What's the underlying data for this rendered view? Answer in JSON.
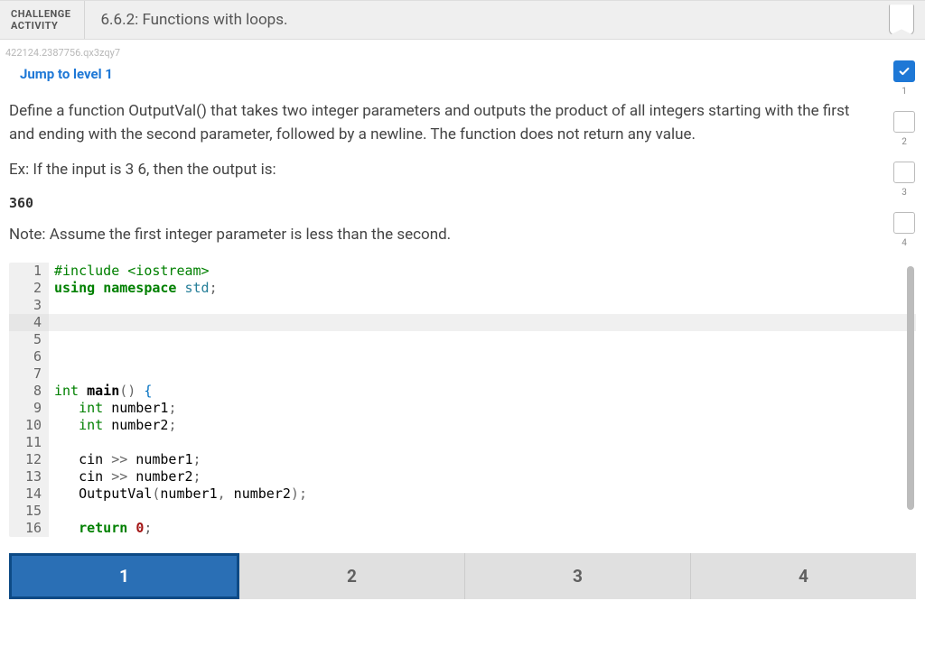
{
  "header": {
    "type_line1": "CHALLENGE",
    "type_line2": "ACTIVITY",
    "title": "6.6.2: Functions with loops."
  },
  "tracking_id": "422124.2387756.qx3zqy7",
  "jump_link": "Jump to level 1",
  "problem": {
    "description": "Define a function OutputVal() that takes two integer parameters and outputs the product of all integers starting with the first and ending with the second parameter, followed by a newline. The function does not return any value.",
    "example_prefix": "Ex: If the input is 3 6, then the output is:",
    "example_output": "360",
    "note": "Note: Assume the first integer parameter is less than the second."
  },
  "code_lines": [
    {
      "n": 1,
      "tokens": [
        {
          "t": "#include ",
          "c": "tok-inc"
        },
        {
          "t": "<iostream>",
          "c": "tok-str"
        }
      ]
    },
    {
      "n": 2,
      "tokens": [
        {
          "t": "using",
          "c": "tok-kw"
        },
        {
          "t": " ",
          "c": ""
        },
        {
          "t": "namespace",
          "c": "tok-kw"
        },
        {
          "t": " ",
          "c": ""
        },
        {
          "t": "std",
          "c": "tok-ns"
        },
        {
          "t": ";",
          "c": "tok-punc"
        }
      ]
    },
    {
      "n": 3,
      "tokens": []
    },
    {
      "n": 4,
      "tokens": [],
      "current": true
    },
    {
      "n": 5,
      "tokens": []
    },
    {
      "n": 6,
      "tokens": []
    },
    {
      "n": 7,
      "tokens": []
    },
    {
      "n": 8,
      "tokens": [
        {
          "t": "int",
          "c": "tok-type"
        },
        {
          "t": " ",
          "c": ""
        },
        {
          "t": "main",
          "c": "tok-fn"
        },
        {
          "t": "()",
          "c": "tok-punc"
        },
        {
          "t": " ",
          "c": ""
        },
        {
          "t": "{",
          "c": "tok-brace"
        }
      ]
    },
    {
      "n": 9,
      "tokens": [
        {
          "t": "   ",
          "c": ""
        },
        {
          "t": "int",
          "c": "tok-type"
        },
        {
          "t": " number1",
          "c": "tok-ident"
        },
        {
          "t": ";",
          "c": "tok-punc"
        }
      ]
    },
    {
      "n": 10,
      "tokens": [
        {
          "t": "   ",
          "c": ""
        },
        {
          "t": "int",
          "c": "tok-type"
        },
        {
          "t": " number2",
          "c": "tok-ident"
        },
        {
          "t": ";",
          "c": "tok-punc"
        }
      ]
    },
    {
      "n": 11,
      "tokens": []
    },
    {
      "n": 12,
      "tokens": [
        {
          "t": "   cin ",
          "c": "tok-ident"
        },
        {
          "t": ">>",
          "c": "tok-op"
        },
        {
          "t": " number1",
          "c": "tok-ident"
        },
        {
          "t": ";",
          "c": "tok-punc"
        }
      ]
    },
    {
      "n": 13,
      "tokens": [
        {
          "t": "   cin ",
          "c": "tok-ident"
        },
        {
          "t": ">>",
          "c": "tok-op"
        },
        {
          "t": " number2",
          "c": "tok-ident"
        },
        {
          "t": ";",
          "c": "tok-punc"
        }
      ]
    },
    {
      "n": 14,
      "tokens": [
        {
          "t": "   OutputVal",
          "c": "tok-ident"
        },
        {
          "t": "(",
          "c": "tok-punc"
        },
        {
          "t": "number1",
          "c": "tok-ident"
        },
        {
          "t": ",",
          "c": "tok-punc"
        },
        {
          "t": " number2",
          "c": "tok-ident"
        },
        {
          "t": ")",
          "c": "tok-punc"
        },
        {
          "t": ";",
          "c": "tok-punc"
        }
      ]
    },
    {
      "n": 15,
      "tokens": []
    },
    {
      "n": 16,
      "tokens": [
        {
          "t": "   ",
          "c": ""
        },
        {
          "t": "return",
          "c": "tok-kw"
        },
        {
          "t": " ",
          "c": ""
        },
        {
          "t": "0",
          "c": "tok-num"
        },
        {
          "t": ";",
          "c": "tok-punc"
        }
      ]
    }
  ],
  "levels": [
    {
      "n": "1",
      "done": true
    },
    {
      "n": "2",
      "done": false
    },
    {
      "n": "3",
      "done": false
    },
    {
      "n": "4",
      "done": false
    }
  ],
  "tabs": [
    {
      "label": "1",
      "active": true
    },
    {
      "label": "2",
      "active": false
    },
    {
      "label": "3",
      "active": false
    },
    {
      "label": "4",
      "active": false
    }
  ]
}
